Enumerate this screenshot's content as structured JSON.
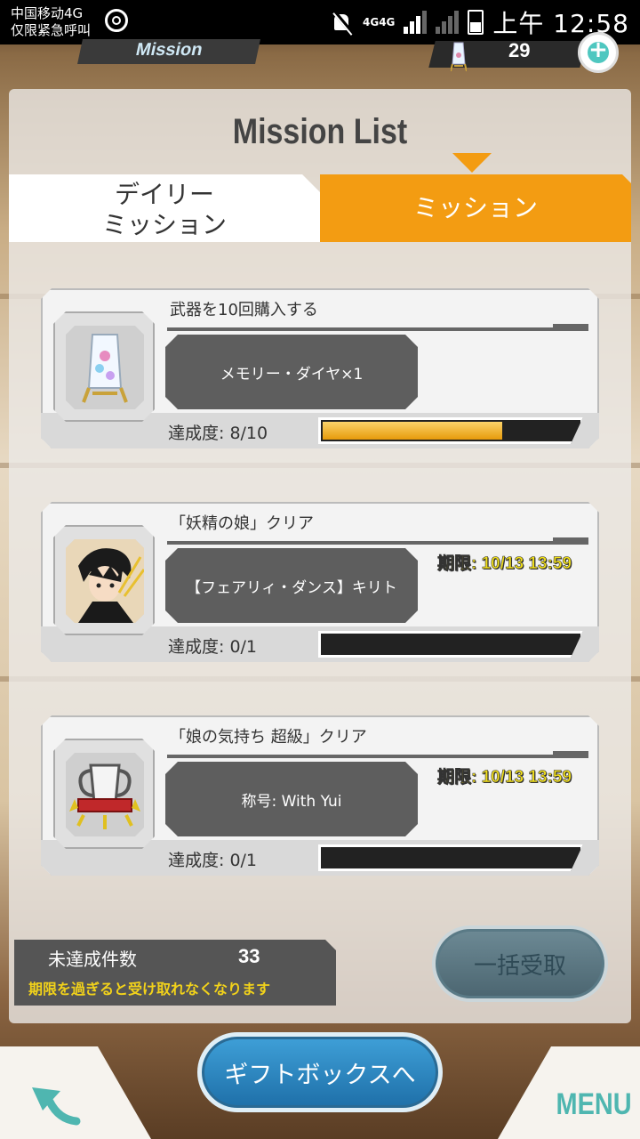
{
  "status_bar": {
    "carrier_line1": "中国移动4G",
    "carrier_line2": "仅限紧急呼叫",
    "network": "4G4G",
    "time": "上午 12:58",
    "icons": [
      "settings-ring-icon",
      "mute-icon",
      "signal-icon",
      "battery-icon"
    ]
  },
  "header": {
    "section_tab": "Mission",
    "gem_count": "29",
    "plus_icon": "plus-icon"
  },
  "panel": {
    "title": "Mission List",
    "tabs": [
      {
        "label_line1": "デイリー",
        "label_line2": "ミッション",
        "active": false
      },
      {
        "label": "ミッション",
        "active": true
      }
    ],
    "accent_color": "#f39c12"
  },
  "missions": [
    {
      "title": "武器を10回購入する",
      "reward": "メモリー・ダイヤ×1",
      "icon": "memory-diamond-icon",
      "progress_label": "達成度: 8/10",
      "progress_value": 0.8,
      "deadline": ""
    },
    {
      "title": "「妖精の娘」クリア",
      "reward": "【フェアリィ・ダンス】キリト",
      "icon": "kirito-portrait-icon",
      "progress_label": "達成度: 0/1",
      "progress_value": 0,
      "deadline": "期限:  10/13 13:59"
    },
    {
      "title": "「娘の気持ち 超級」クリア",
      "reward": "称号: With Yui",
      "icon": "trophy-title-icon",
      "progress_label": "達成度: 0/1",
      "progress_value": 0,
      "deadline": "期限:  10/13 13:59"
    }
  ],
  "footer": {
    "remaining_label": "未達成件数",
    "remaining_count": "33",
    "remaining_note": "期限を過ぎると受け取れなくなります",
    "claim_all": "一括受取",
    "gift_box": "ギフトボックスへ",
    "menu": "MENU",
    "back_icon": "back-arrow-icon"
  }
}
